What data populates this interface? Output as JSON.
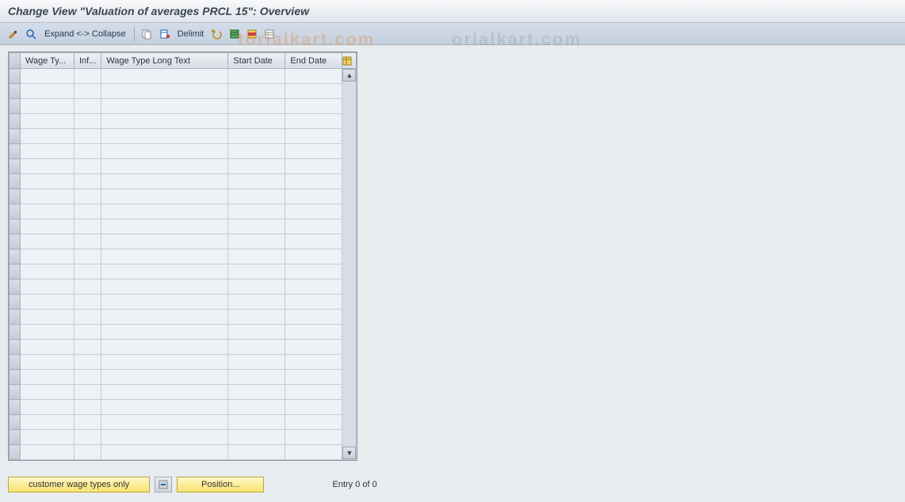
{
  "header": {
    "title": "Change View \"Valuation of averages PRCL 15\": Overview"
  },
  "toolbar": {
    "expand_label": "Expand <-> Collapse",
    "delimit_label": "Delimit"
  },
  "table": {
    "columns": {
      "wage_type": "Wage Ty...",
      "inf": "Inf...",
      "long_text": "Wage Type Long Text",
      "start_date": "Start Date",
      "end_date": "End Date"
    },
    "row_count": 26
  },
  "footer": {
    "customer_btn": "customer wage types only",
    "position_btn": "Position...",
    "entry_text": "Entry 0 of 0"
  },
  "watermark": {
    "part1": "torialkart.com",
    "part2": "orialkart.com"
  }
}
